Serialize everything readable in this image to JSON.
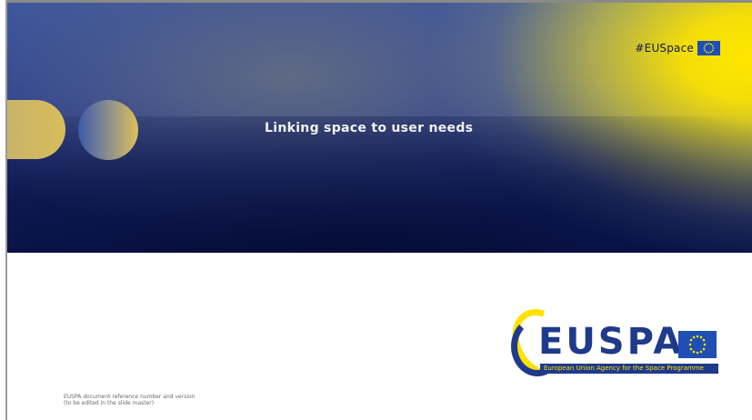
{
  "banner": {
    "hashtag": "#EUSpace",
    "tagline": "Linking space to user needs"
  },
  "logo": {
    "wordmark": "EUSPA",
    "agency_name": "European Union Agency for the Space Programme"
  },
  "footer": {
    "line1": "EUSPA document reference number and version",
    "line2": "(to be edited in the slide master)"
  },
  "colors": {
    "eu_blue": "#1f3a8a",
    "eu_yellow": "#ffe100"
  },
  "icons": {
    "flag": "eu-flag-icon"
  }
}
